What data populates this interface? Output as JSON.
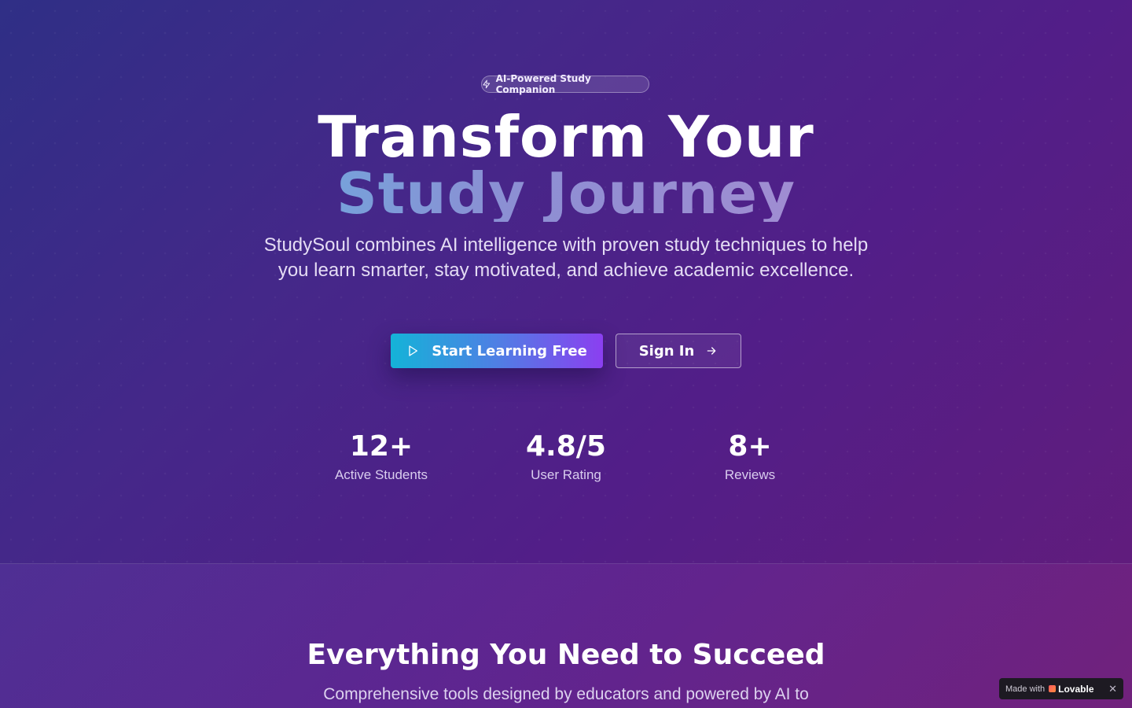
{
  "hero": {
    "badge": {
      "icon": "lightning-icon",
      "label": "AI-Powered Study Companion"
    },
    "heading_line1": "Transform Your",
    "heading_line2": "Study Journey",
    "subtitle": "StudySoul combines AI intelligence with proven study techniques to help you learn smarter, stay motivated, and achieve academic excellence.",
    "primary_button": {
      "icon": "play-icon",
      "label": "Start Learning Free"
    },
    "secondary_button": {
      "label": "Sign In",
      "icon": "arrow-right-icon"
    },
    "stats": [
      {
        "value": "12+",
        "label": "Active Students"
      },
      {
        "value": "4.8/5",
        "label": "User Rating"
      },
      {
        "value": "8+",
        "label": "Reviews"
      }
    ]
  },
  "features": {
    "title": "Everything You Need to Succeed",
    "subtitle": "Comprehensive tools designed by educators and powered by AI to"
  },
  "lovable_badge": {
    "prefix": "Made with",
    "brand": "Lovable",
    "close": "✕"
  },
  "colors": {
    "background_start": "#2f2f86",
    "background_end": "#641c7a",
    "primary_gradient_start": "#14b3d8",
    "primary_gradient_end": "#8b3ff0",
    "heading_gradient_start": "#4fc3e8",
    "heading_gradient_end": "#b78bd1"
  }
}
